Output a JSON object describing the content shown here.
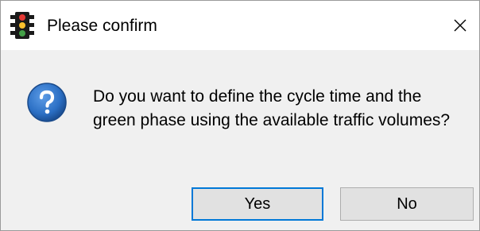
{
  "window": {
    "title": "Please confirm",
    "app_icon": "traffic-light-icon",
    "close_icon": "close-icon"
  },
  "message": {
    "icon": "question-icon",
    "text": "Do you want to define the cycle time and the green phase using the available traffic volumes?"
  },
  "buttons": {
    "yes_label": "Yes",
    "no_label": "No",
    "default": "Yes"
  },
  "colors": {
    "focus_border": "#0078d7",
    "question_icon": "#2b6fc4"
  }
}
